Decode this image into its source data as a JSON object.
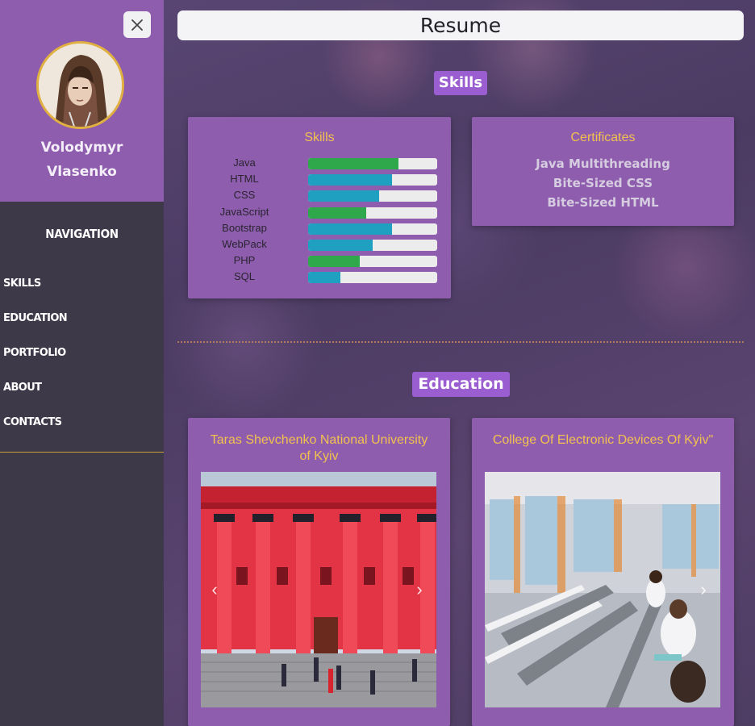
{
  "app_title": "Resume",
  "profile": {
    "close_label": "×",
    "name_line1": "Volodymyr",
    "name_line2": "Vlasenko"
  },
  "navigation": {
    "title": "NAVIGATION",
    "items": [
      {
        "label": "SKILLS"
      },
      {
        "label": "EDUCATION"
      },
      {
        "label": "PORTFOLIO"
      },
      {
        "label": "ABOUT"
      },
      {
        "label": "CONTACTS"
      }
    ]
  },
  "skills_section": {
    "badge": "Skills",
    "skills_card": {
      "title": "Skills",
      "items": [
        {
          "name": "Java",
          "level": 0.7,
          "color": "#2ea84a"
        },
        {
          "name": "HTML",
          "level": 0.65,
          "color": "#1fa0c0"
        },
        {
          "name": "CSS",
          "level": 0.55,
          "color": "#1fa0c0"
        },
        {
          "name": "JavaScript",
          "level": 0.45,
          "color": "#2ea84a"
        },
        {
          "name": "Bootstrap",
          "level": 0.65,
          "color": "#1fa0c0"
        },
        {
          "name": "WebPack",
          "level": 0.5,
          "color": "#1fa0c0"
        },
        {
          "name": "PHP",
          "level": 0.4,
          "color": "#2ea84a"
        },
        {
          "name": "SQL",
          "level": 0.25,
          "color": "#1fa0c0"
        }
      ]
    },
    "certificates_card": {
      "title": "Certificates",
      "items": [
        "Java Multithreading",
        "Bite-Sized CSS",
        "Bite-Sized HTML"
      ]
    }
  },
  "education_section": {
    "badge": "Education",
    "items": [
      {
        "title": "Taras Shevchenko National University of Kyiv",
        "prev_label": "‹",
        "next_label": "›"
      },
      {
        "title": "College Of Electronic Devices Of Kyiv\"",
        "next_label": "›"
      }
    ]
  },
  "colors": {
    "accent_purple": "#8e5dae",
    "badge_purple": "#9a5ed0",
    "title_gold": "#f2c14e",
    "sidebar_dark": "#3e3949"
  }
}
